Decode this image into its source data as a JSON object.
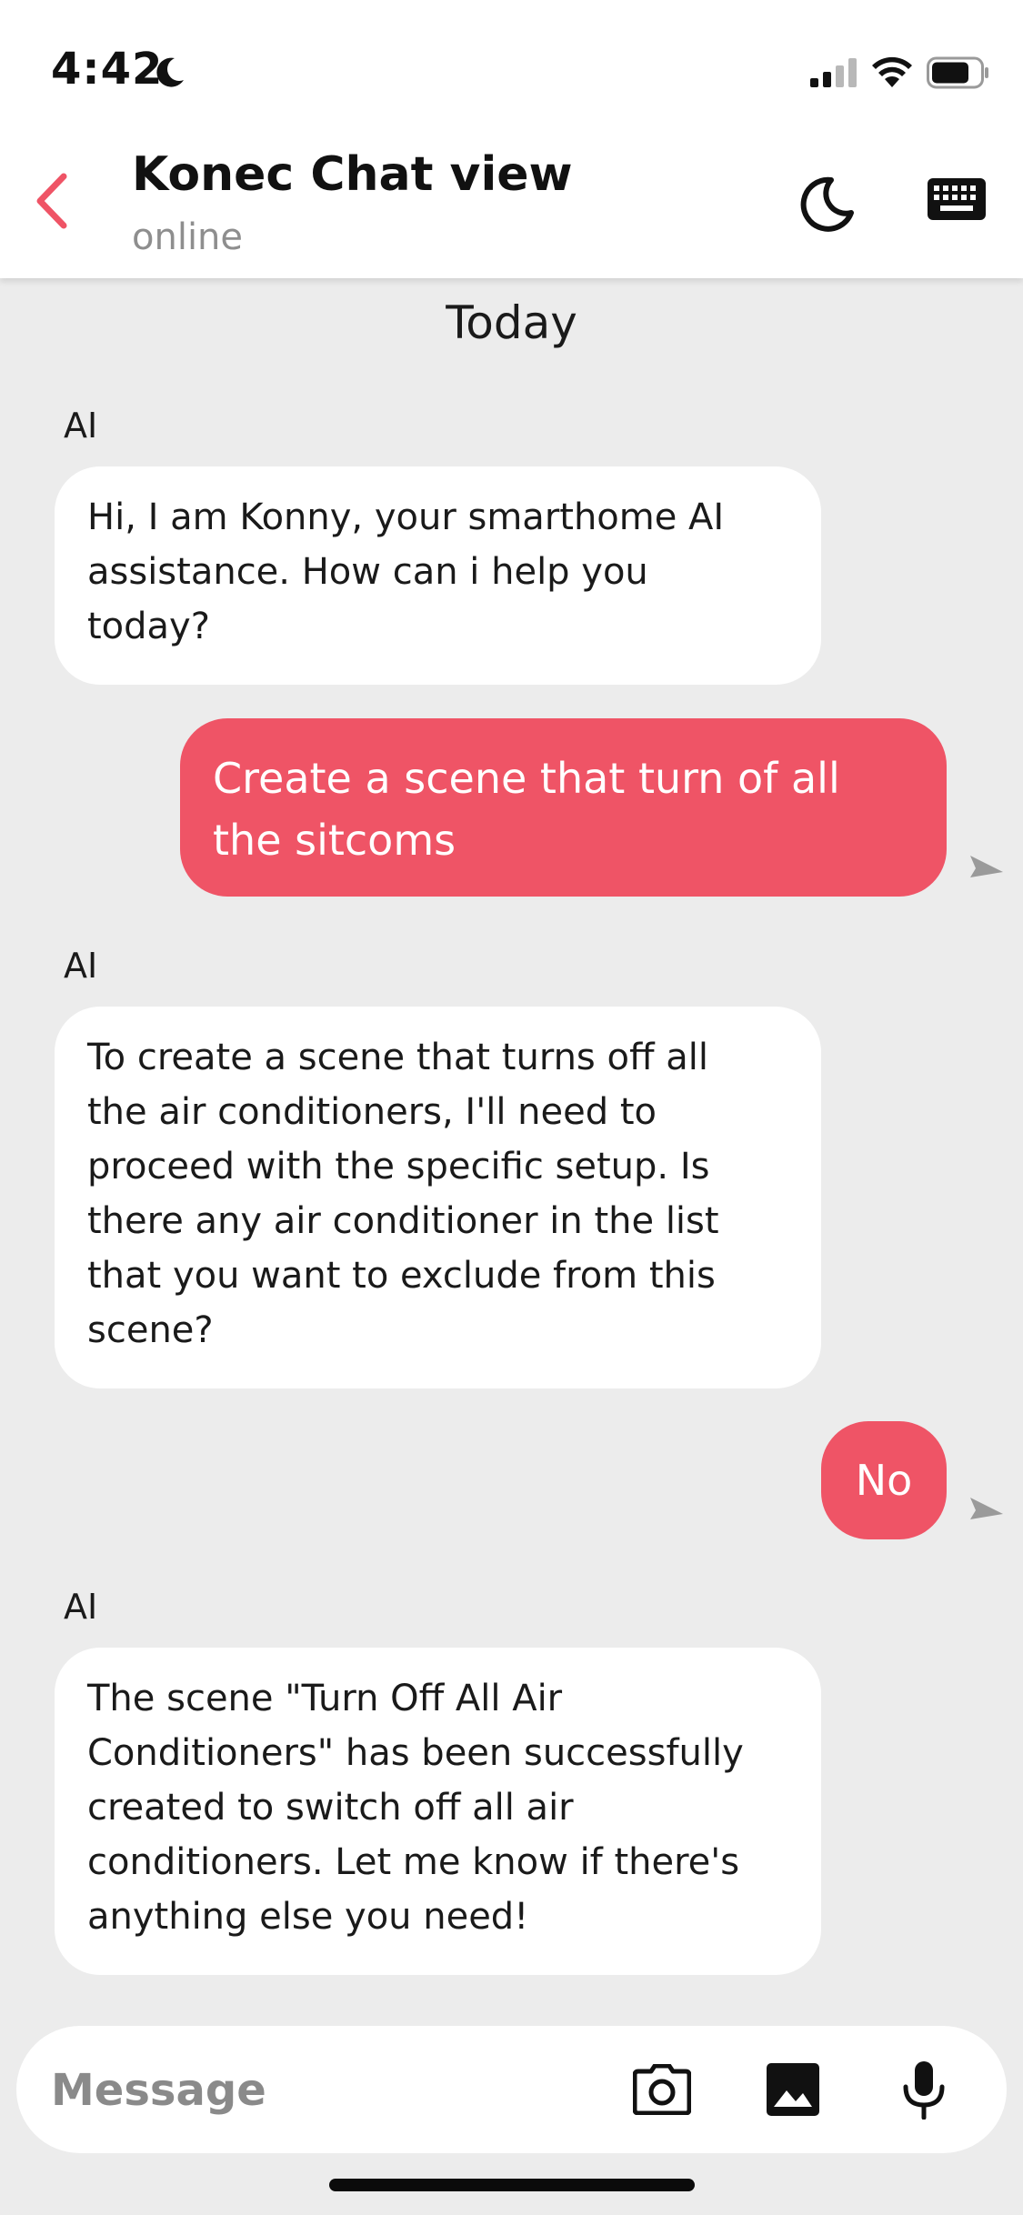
{
  "status_bar": {
    "time": "4:42"
  },
  "header": {
    "title": "Konec Chat view",
    "status": "online"
  },
  "chat": {
    "date_label": "Today",
    "messages": [
      {
        "role": "ai",
        "sender": "AI",
        "lines": [
          "Hi, I am Konny, your smarthome AI",
          "assistance. How can i help you",
          "today?"
        ]
      },
      {
        "role": "user",
        "lines": [
          "Create a scene that turn of all",
          "the sitcoms"
        ]
      },
      {
        "role": "ai",
        "sender": "AI",
        "lines": [
          "To create a scene that turns off all",
          "the air conditioners, I'll need to",
          "proceed with the specific setup. Is",
          "there any air conditioner in the list",
          "that you want to exclude from this",
          "scene?"
        ]
      },
      {
        "role": "user",
        "lines": [
          "No"
        ]
      },
      {
        "role": "ai",
        "sender": "AI",
        "lines": [
          "The scene \"Turn Off All Air",
          "Conditioners\" has been successfully",
          "created to switch off all air",
          "conditioners. Let me know if there's",
          "anything else you need!"
        ]
      }
    ]
  },
  "composer": {
    "placeholder": "Message"
  },
  "colors": {
    "accent": "#ef5466",
    "background": "#ececec",
    "bubble_ai": "#ffffff"
  },
  "icons": {
    "back": "chevron-left-icon",
    "theme": "moon-icon",
    "keyboard": "keyboard-icon",
    "camera": "camera-icon",
    "gallery": "image-icon",
    "mic": "microphone-icon",
    "sent": "sent-arrow-icon"
  }
}
